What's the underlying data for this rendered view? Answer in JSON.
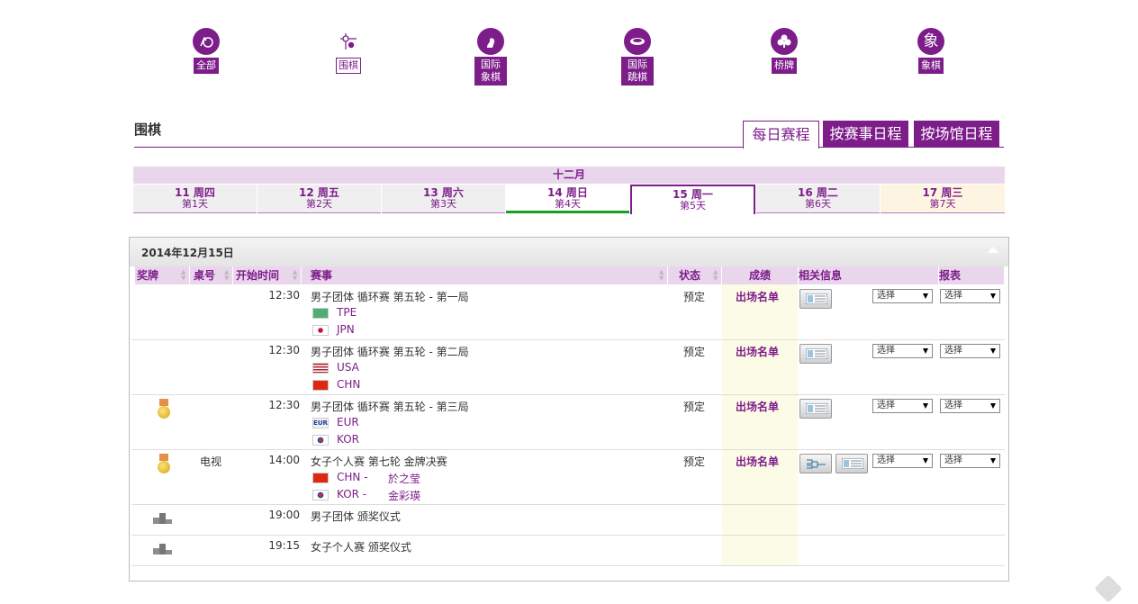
{
  "sports": [
    {
      "label": "全部",
      "icon": "all-sports-icon",
      "selected": false
    },
    {
      "label": "围棋",
      "icon": "go-icon",
      "selected": true
    },
    {
      "label": "国际象棋",
      "icon": "chess-icon",
      "selected": false
    },
    {
      "label": "国际跳棋",
      "icon": "draughts-icon",
      "selected": false
    },
    {
      "label": "桥牌",
      "icon": "bridge-club-icon",
      "selected": false
    },
    {
      "label": "象棋",
      "icon": "xiangqi-icon",
      "selected": false
    }
  ],
  "xiangqi_glyph": "象",
  "page_title": "围棋",
  "tabs": [
    "每日赛程",
    "按赛事日程",
    "按场馆日程"
  ],
  "month": "十二月",
  "days": [
    {
      "d1": "11 周四",
      "d2": "第1天"
    },
    {
      "d1": "12 周五",
      "d2": "第2天"
    },
    {
      "d1": "13 周六",
      "d2": "第3天"
    },
    {
      "d1": "14 周日",
      "d2": "第4天"
    },
    {
      "d1": "15 周一",
      "d2": "第5天"
    },
    {
      "d1": "16 周二",
      "d2": "第6天"
    },
    {
      "d1": "17 周三",
      "d2": "第7天"
    }
  ],
  "panel_date": "2014年12月15日",
  "headers": {
    "medal": "奖牌",
    "table": "桌号",
    "start": "开始时间",
    "event": "赛事",
    "status": "状态",
    "score": "成绩",
    "info": "相关信息",
    "report": "报表"
  },
  "rows": [
    {
      "time": "12:30",
      "event": "男子团体 循环赛 第五轮 - 第一局",
      "status": "预定",
      "score": "出场名单",
      "team1": "TPE",
      "team2": "JPN",
      "select1": "选择",
      "select2": "选择"
    },
    {
      "time": "12:30",
      "event": "男子团体 循环赛 第五轮 - 第二局",
      "status": "预定",
      "score": "出场名单",
      "team1": "USA",
      "team2": "CHN",
      "select1": "选择",
      "select2": "选择"
    },
    {
      "time": "12:30",
      "event": "男子团体 循环赛 第五轮 - 第三局",
      "status": "预定",
      "score": "出场名单",
      "team1": "EUR",
      "team2": "KOR",
      "select1": "选择",
      "select2": "选择"
    },
    {
      "time": "14:00",
      "table": "电视",
      "event": "女子个人赛 第七轮 金牌决赛",
      "status": "预定",
      "score": "出场名单",
      "team1": "CHN -",
      "player1": "於之莹",
      "team2": "KOR -",
      "player2": "金彩瑛",
      "select1": "选择",
      "select2": "选择"
    },
    {
      "time": "19:00",
      "event": "男子团体 颁奖仪式"
    },
    {
      "time": "19:15",
      "event": "女子个人赛 颁奖仪式"
    }
  ],
  "colors": {
    "accent": "#7d1d8a",
    "header_bg": "#ead6ec",
    "today": "#1aa01a"
  }
}
